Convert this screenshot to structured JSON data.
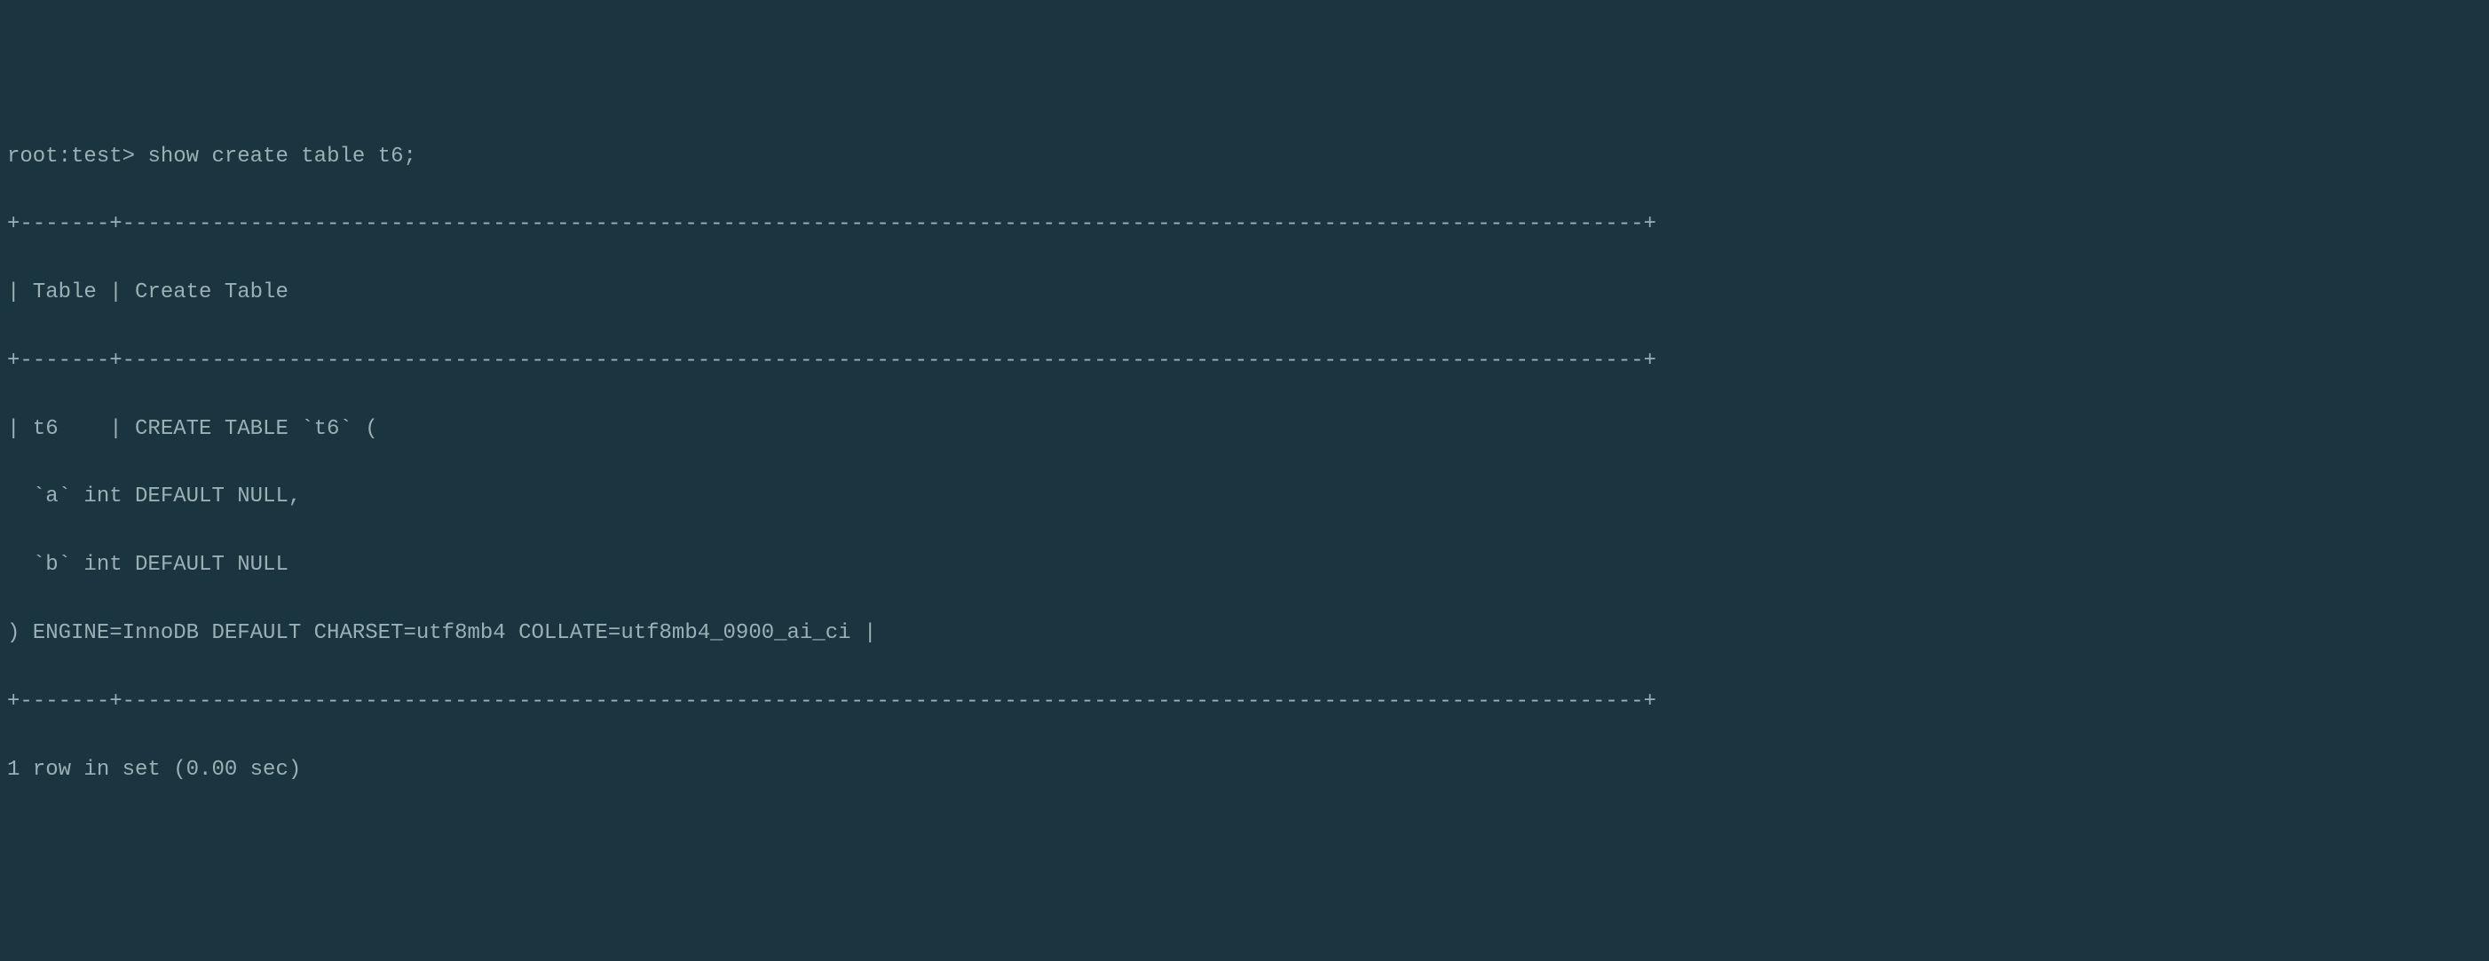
{
  "terminal": {
    "prompt": "root:test> ",
    "command": "show create table t6;",
    "border_top": "+-------+-----------------------------------------------------------------------------------------------------------------------+",
    "header_line": "| Table | Create Table",
    "border_mid": "+-------+-----------------------------------------------------------------------------------------------------------------------+",
    "data_line1": "| t6    | CREATE TABLE `t6` (",
    "data_line2": "  `a` int DEFAULT NULL,",
    "data_line3": "  `b` int DEFAULT NULL",
    "data_line4": ") ENGINE=InnoDB DEFAULT CHARSET=utf8mb4 COLLATE=utf8mb4_0900_ai_ci |",
    "border_bottom": "+-------+-----------------------------------------------------------------------------------------------------------------------+",
    "status": "1 row in set (0.00 sec)"
  }
}
